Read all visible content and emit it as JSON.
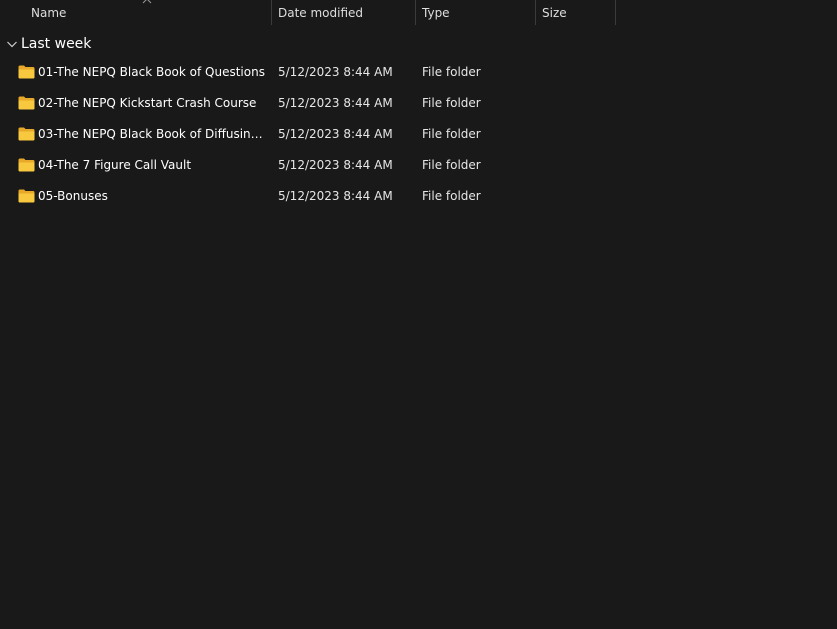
{
  "columns": {
    "name": "Name",
    "date_modified": "Date modified",
    "type": "Type",
    "size": "Size"
  },
  "sort": {
    "column": "name",
    "icon": "chevron-up-icon"
  },
  "group": {
    "label": "Last week",
    "icon": "chevron-down-icon",
    "expanded": true
  },
  "folder_icon_color": "#f8c93f",
  "rows": [
    {
      "name": "01-The NEPQ Black Book of Questions",
      "date": "5/12/2023 8:44 AM",
      "type": "File folder",
      "size": ""
    },
    {
      "name": "02-The NEPQ Kickstart Crash Course",
      "date": "5/12/2023 8:44 AM",
      "type": "File folder",
      "size": ""
    },
    {
      "name": "03-The NEPQ Black Book of Diffusing Ob...",
      "date": "5/12/2023 8:44 AM",
      "type": "File folder",
      "size": ""
    },
    {
      "name": "04-The 7 Figure Call Vault",
      "date": "5/12/2023 8:44 AM",
      "type": "File folder",
      "size": ""
    },
    {
      "name": "05-Bonuses",
      "date": "5/12/2023 8:44 AM",
      "type": "File folder",
      "size": ""
    }
  ]
}
